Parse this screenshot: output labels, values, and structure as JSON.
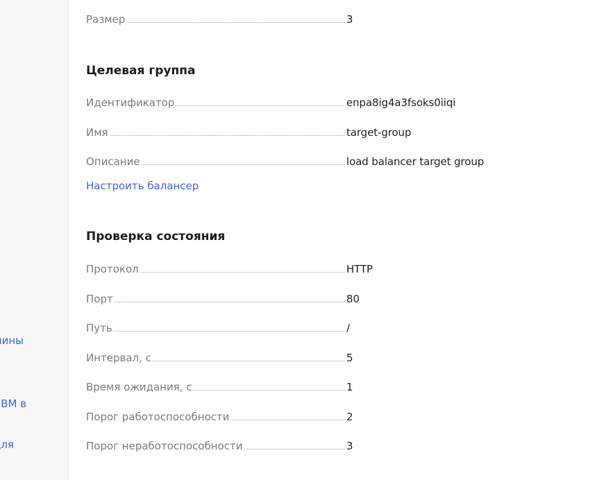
{
  "sidebar": {
    "links": [
      {
        "text": "ашины"
      },
      {
        "text": "ВМ в"
      },
      {
        "text": "для"
      }
    ]
  },
  "size_row": {
    "label": "Размер",
    "value": "3"
  },
  "target_group": {
    "title": "Целевая группа",
    "rows": [
      {
        "label": "Идентификатор",
        "value": "enpa8ig4a3fsoks0iiqi"
      },
      {
        "label": "Имя",
        "value": "target-group"
      },
      {
        "label": "Описание",
        "value": "load balancer target group"
      }
    ],
    "configure_link": "Настроить балансер"
  },
  "health_check": {
    "title": "Проверка состояния",
    "rows": [
      {
        "label": "Протокол",
        "value": "HTTP"
      },
      {
        "label": "Порт",
        "value": "80"
      },
      {
        "label": "Путь",
        "value": "/"
      },
      {
        "label": "Интервал, с",
        "value": "5"
      },
      {
        "label": "Время ожидания, с",
        "value": "1"
      },
      {
        "label": "Порог работоспособности",
        "value": "2"
      },
      {
        "label": "Порог неработоспособности",
        "value": "3"
      }
    ]
  },
  "colors": {
    "link": "#3a66d6",
    "label": "#7a7a7a",
    "sidebar_bg": "#f7f7f8"
  }
}
